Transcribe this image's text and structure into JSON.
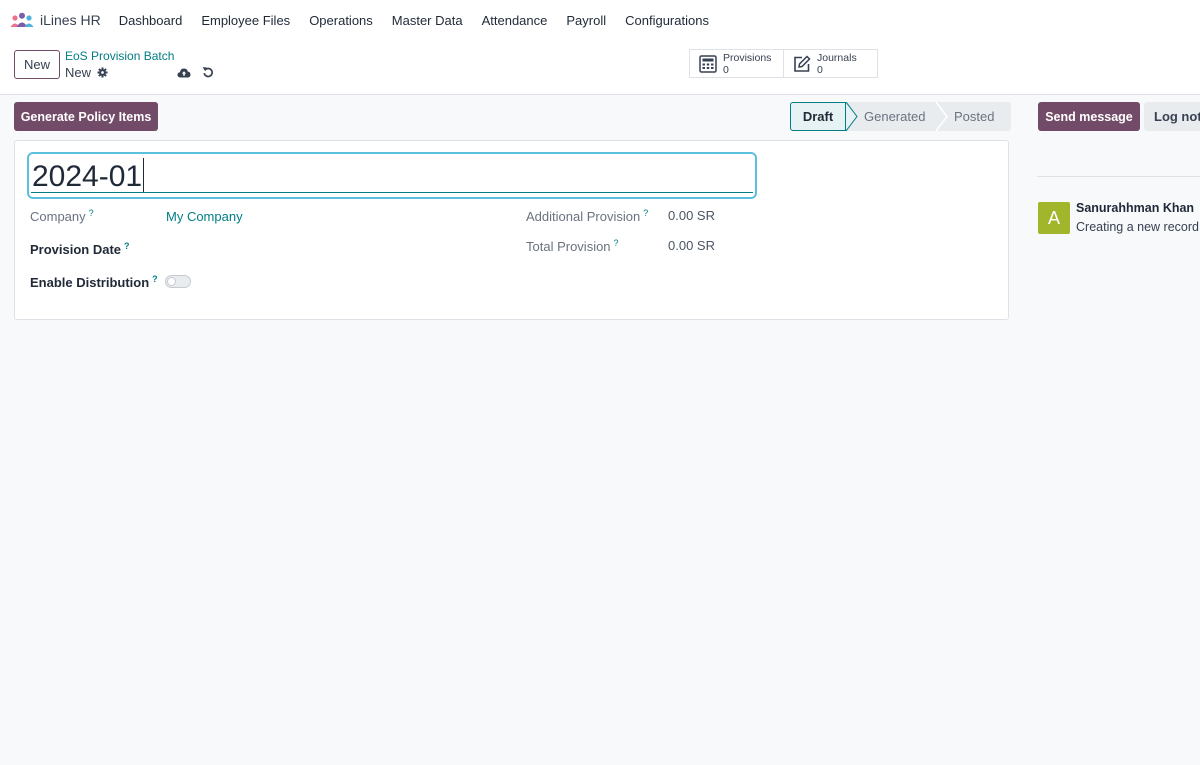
{
  "app": {
    "name": "iLines HR",
    "menu": [
      "Dashboard",
      "Employee Files",
      "Operations",
      "Master Data",
      "Attendance",
      "Payroll",
      "Configurations"
    ]
  },
  "control_panel": {
    "new_button": "New",
    "breadcrumb_parent": "EoS Provision Batch",
    "breadcrumb_current": "New",
    "stat_buttons": [
      {
        "label": "Provisions",
        "value": "0",
        "icon": "calculator-icon"
      },
      {
        "label": "Journals",
        "value": "0",
        "icon": "edit-icon"
      }
    ]
  },
  "actions": {
    "generate_button": "Generate Policy Items"
  },
  "status_bar": {
    "stages": [
      "Draft",
      "Generated",
      "Posted"
    ],
    "active": "Draft"
  },
  "form": {
    "name_value": "2024-01",
    "help_mark": "?",
    "fields": {
      "company_label": "Company",
      "company_value": "My Company",
      "provision_date_label": "Provision Date",
      "enable_distribution_label": "Enable Distribution",
      "additional_provision_label": "Additional Provision",
      "additional_provision_value": "0.00 SR",
      "total_provision_label": "Total Provision",
      "total_provision_value": "0.00 SR"
    },
    "enable_distribution_on": false
  },
  "chatter": {
    "send_message": "Send message",
    "log_note": "Log note",
    "message": {
      "avatar_letter": "A",
      "author": "Sanurahhman Khan",
      "body": "Creating a new record..."
    }
  },
  "colors": {
    "brand": "#714b67",
    "accent": "#017e84",
    "focus": "#5bc0de",
    "avatar": "#a2b62c"
  }
}
